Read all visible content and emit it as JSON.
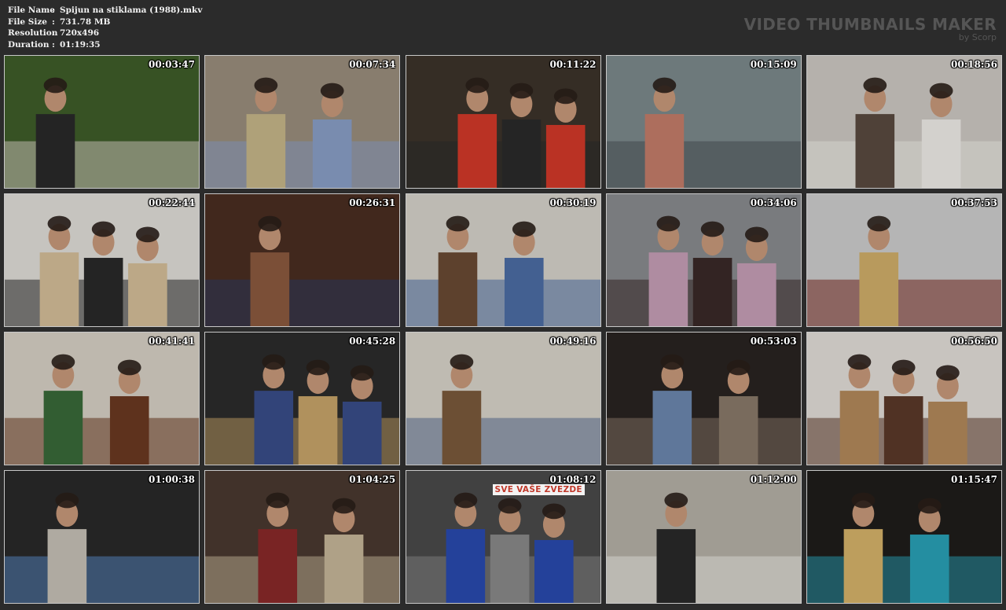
{
  "file_info": {
    "rows": [
      {
        "label": "File Name",
        "value": "Spijun na stiklama (1988).mkv"
      },
      {
        "label": "File Size",
        "value": "731.78 MB"
      },
      {
        "label": "Resolution",
        "value": "720x496"
      },
      {
        "label": "Duration",
        "value": "01:19:35"
      }
    ],
    "separator": ":"
  },
  "brand": {
    "title": "VIDEO THUMBNAILS MAKER",
    "subtitle": "by Scorp"
  },
  "thumbnails": [
    {
      "timestamp": "00:03:47",
      "palette": [
        "#3f5e2a",
        "#d9cfc4",
        "#2a2a2a"
      ]
    },
    {
      "timestamp": "00:07:34",
      "palette": [
        "#9b8f7e",
        "#8aa0c8",
        "#c8b88a"
      ]
    },
    {
      "timestamp": "00:11:22",
      "palette": [
        "#3d342b",
        "#2b2b2b",
        "#d43a2a"
      ]
    },
    {
      "timestamp": "00:15:09",
      "palette": [
        "#7d8a8c",
        "#4a5258",
        "#c57e6a"
      ]
    },
    {
      "timestamp": "00:18:56",
      "palette": [
        "#cfcac4",
        "#f1eeea",
        "#5a4a40"
      ]
    },
    {
      "timestamp": "00:22:44",
      "palette": [
        "#e2e0da",
        "#2a2a2a",
        "#d7c09a"
      ]
    },
    {
      "timestamp": "00:26:31",
      "palette": [
        "#4a2e22",
        "#2d3d63",
        "#8c5b3f"
      ]
    },
    {
      "timestamp": "00:30:19",
      "palette": [
        "#d8d4cc",
        "#4d6ea6",
        "#6a4a34"
      ]
    },
    {
      "timestamp": "00:34:06",
      "palette": [
        "#8a8d90",
        "#3b2a28",
        "#c8a0b8"
      ]
    },
    {
      "timestamp": "00:37:53",
      "palette": [
        "#cfcfcf",
        "#7a2a20",
        "#d2b06a"
      ]
    },
    {
      "timestamp": "00:41:41",
      "palette": [
        "#d9d2c6",
        "#6b3a22",
        "#3a6a3a"
      ]
    },
    {
      "timestamp": "00:45:28",
      "palette": [
        "#2c2c2c",
        "#c9a56a",
        "#3a4e8a"
      ]
    },
    {
      "timestamp": "00:49:16",
      "palette": [
        "#dad5cb",
        "#5a6f93",
        "#7b5a3c"
      ]
    },
    {
      "timestamp": "00:53:03",
      "palette": [
        "#2a2422",
        "#8a7a6a",
        "#6d88b0"
      ]
    },
    {
      "timestamp": "00:56:50",
      "palette": [
        "#e4e0da",
        "#5c3a2a",
        "#b48a5c"
      ]
    },
    {
      "timestamp": "01:00:38",
      "palette": [
        "#2a2a2a",
        "#5a8ac8",
        "#c8c2b8"
      ]
    },
    {
      "timestamp": "01:04:25",
      "palette": [
        "#4a3a30",
        "#c8b89a",
        "#8a2a2a"
      ]
    },
    {
      "timestamp": "01:08:12",
      "palette": [
        "#4b4a4a",
        "#8a8a8a",
        "#2a4ab0"
      ]
    },
    {
      "timestamp": "01:12:00",
      "palette": [
        "#b7b2a8",
        "#efefe8",
        "#2a2a2a"
      ]
    },
    {
      "timestamp": "01:15:47",
      "palette": [
        "#1f1d1b",
        "#2aa2b8",
        "#d8b46a"
      ]
    }
  ],
  "sign_text": "SVE VAŠE ZVEZDE"
}
